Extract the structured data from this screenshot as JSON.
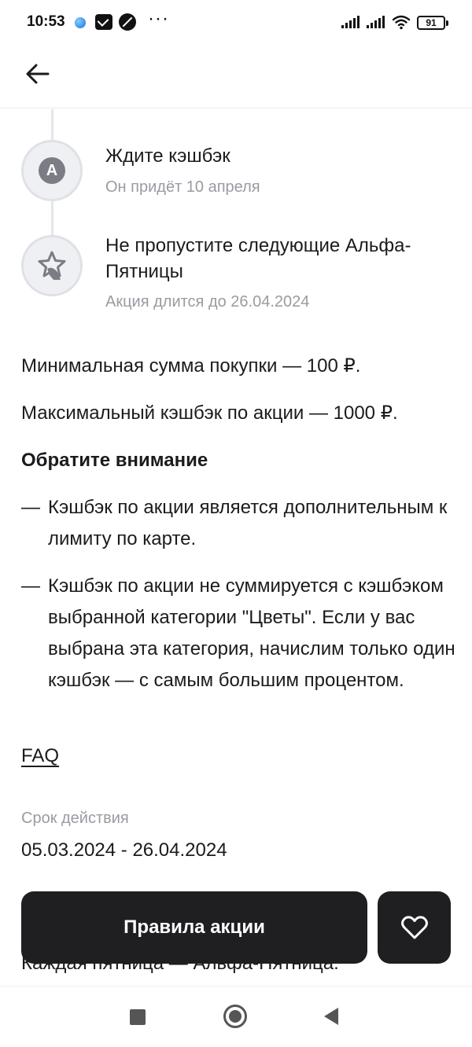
{
  "status_bar": {
    "time": "10:53",
    "more": "···",
    "battery": "91"
  },
  "header": {
    "back_icon": "arrow-left-icon"
  },
  "steps": [
    {
      "icon": "alfa-logo-icon",
      "badge": "A",
      "title": "Ждите кэшбэк",
      "subtitle": "Он придёт 10 апреля"
    },
    {
      "icon": "star-hand-icon",
      "title": "Не пропустите следующие Альфа-Пятницы",
      "subtitle": "Акция длится до 26.04.2024"
    }
  ],
  "info": {
    "min_purchase": "Минимальная сумма покупки — 100 ₽.",
    "max_cashback": "Максимальный кэшбэк по акции — 1000 ₽.",
    "note_title": "Обратите внимание",
    "bullets": [
      "Кэшбэк по акции является дополнительным к лимиту по карте.",
      "Кэшбэк по акции не суммируется с кэшбэком выбранной категории \"Цветы\". Если у вас выбрана эта категория, начислим только один кэшбэк — с самым большим процентом."
    ],
    "bullet_dash": "—",
    "faq": "FAQ"
  },
  "validity": {
    "label": "Срок действия",
    "value": "05.03.2024 - 26.04.2024"
  },
  "partial_text": "Каждая пятница — Альфа-Пятница.",
  "actions": {
    "rules_label": "Правила акции",
    "favorite_icon": "heart-icon"
  },
  "colors": {
    "primary_button": "#1f1f22",
    "muted_text": "#9a9ba2",
    "text": "#1b1b1f"
  }
}
